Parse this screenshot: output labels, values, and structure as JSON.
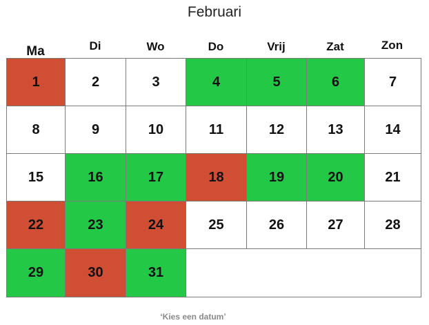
{
  "month_title": "Februari",
  "weekdays": [
    "Ma",
    "Di",
    "Wo",
    "Do",
    "Vrij",
    "Zat",
    "Zon"
  ],
  "days": [
    {
      "label": "1",
      "status": "red"
    },
    {
      "label": "2",
      "status": "white"
    },
    {
      "label": "3",
      "status": "white"
    },
    {
      "label": "4",
      "status": "green"
    },
    {
      "label": "5",
      "status": "green"
    },
    {
      "label": "6",
      "status": "green"
    },
    {
      "label": "7",
      "status": "white"
    },
    {
      "label": "8",
      "status": "white"
    },
    {
      "label": "9",
      "status": "white"
    },
    {
      "label": "10",
      "status": "white"
    },
    {
      "label": "11",
      "status": "white"
    },
    {
      "label": "12",
      "status": "white"
    },
    {
      "label": "13",
      "status": "white"
    },
    {
      "label": "14",
      "status": "white"
    },
    {
      "label": "15",
      "status": "white"
    },
    {
      "label": "16",
      "status": "green"
    },
    {
      "label": "17",
      "status": "green"
    },
    {
      "label": "18",
      "status": "red"
    },
    {
      "label": "19",
      "status": "green"
    },
    {
      "label": "20",
      "status": "green"
    },
    {
      "label": "21",
      "status": "white"
    },
    {
      "label": "22",
      "status": "red"
    },
    {
      "label": "23",
      "status": "green"
    },
    {
      "label": "24",
      "status": "red"
    },
    {
      "label": "25",
      "status": "white"
    },
    {
      "label": "26",
      "status": "white"
    },
    {
      "label": "27",
      "status": "white"
    },
    {
      "label": "28",
      "status": "white"
    },
    {
      "label": "29",
      "status": "green"
    },
    {
      "label": "30",
      "status": "red"
    },
    {
      "label": "31",
      "status": "green"
    }
  ],
  "colors": {
    "red": "#d04e33",
    "green": "#23c846",
    "white": "#ffffff"
  },
  "hint": "‘Kies een datum’"
}
